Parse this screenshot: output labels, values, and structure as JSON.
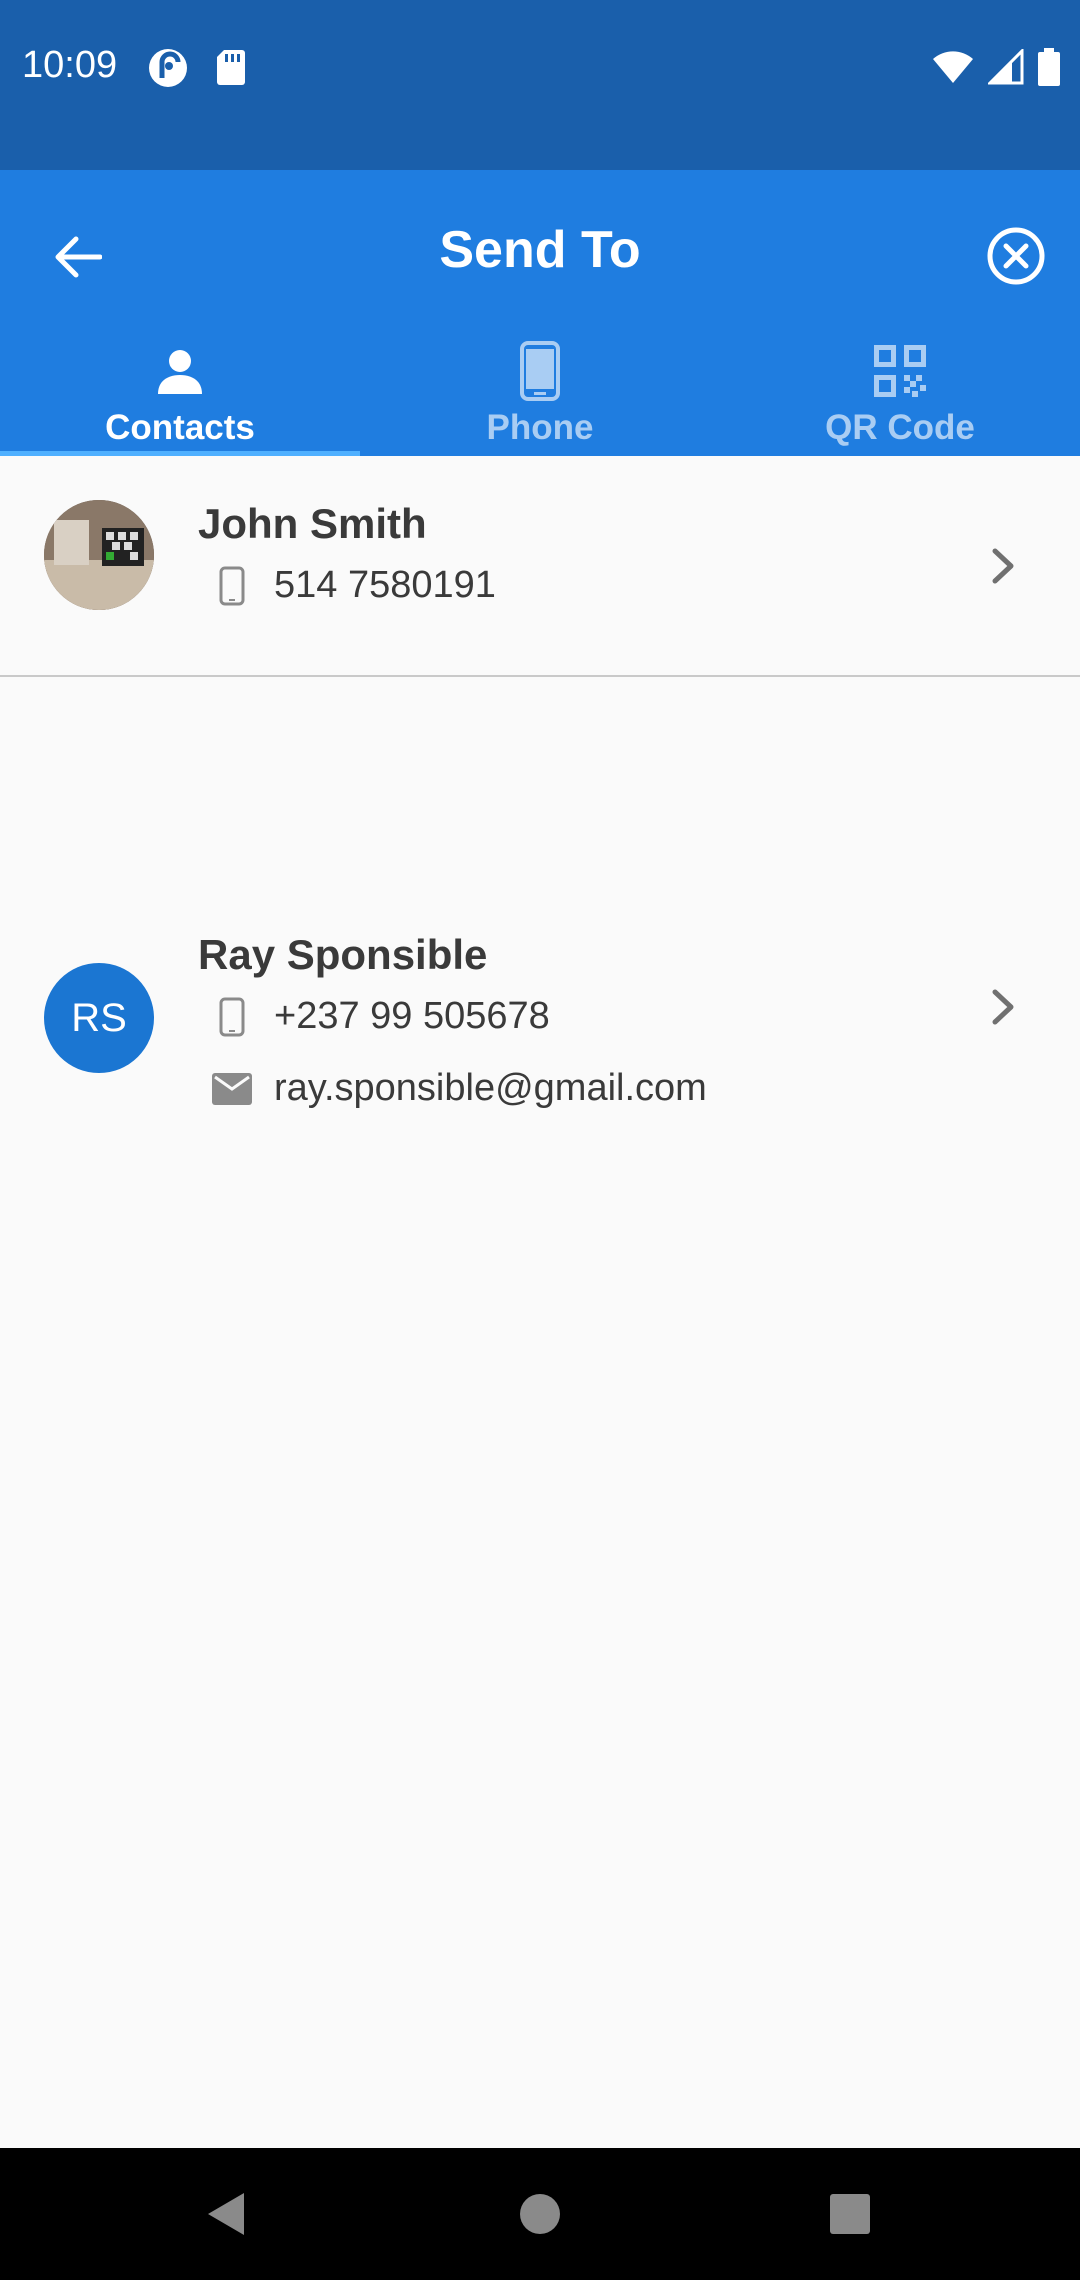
{
  "status_bar": {
    "time": "10:09",
    "icons": [
      "pocket-casts-icon",
      "sd-card-icon",
      "wifi-icon",
      "signal-icon",
      "battery-icon"
    ]
  },
  "app_bar": {
    "title": "Send To",
    "back_icon": "arrow-left-icon",
    "close_icon": "close-circle-icon",
    "background_color": "#1f7de0"
  },
  "tabs": [
    {
      "label": "Contacts",
      "icon": "person-icon",
      "active": true
    },
    {
      "label": "Phone",
      "icon": "smartphone-icon",
      "active": false
    },
    {
      "label": "QR Code",
      "icon": "qr-code-icon",
      "active": false
    }
  ],
  "contacts": [
    {
      "name": "John Smith",
      "avatar": "photo",
      "phone": "514 7580191"
    },
    {
      "name": "Ray Sponsible",
      "avatar_initials": "RS",
      "phone": "+237 99 505678",
      "email": "ray.sponsible@gmail.com"
    }
  ],
  "nav_bar": {
    "buttons": [
      "back-triangle-icon",
      "home-circle-icon",
      "recents-square-icon"
    ]
  }
}
